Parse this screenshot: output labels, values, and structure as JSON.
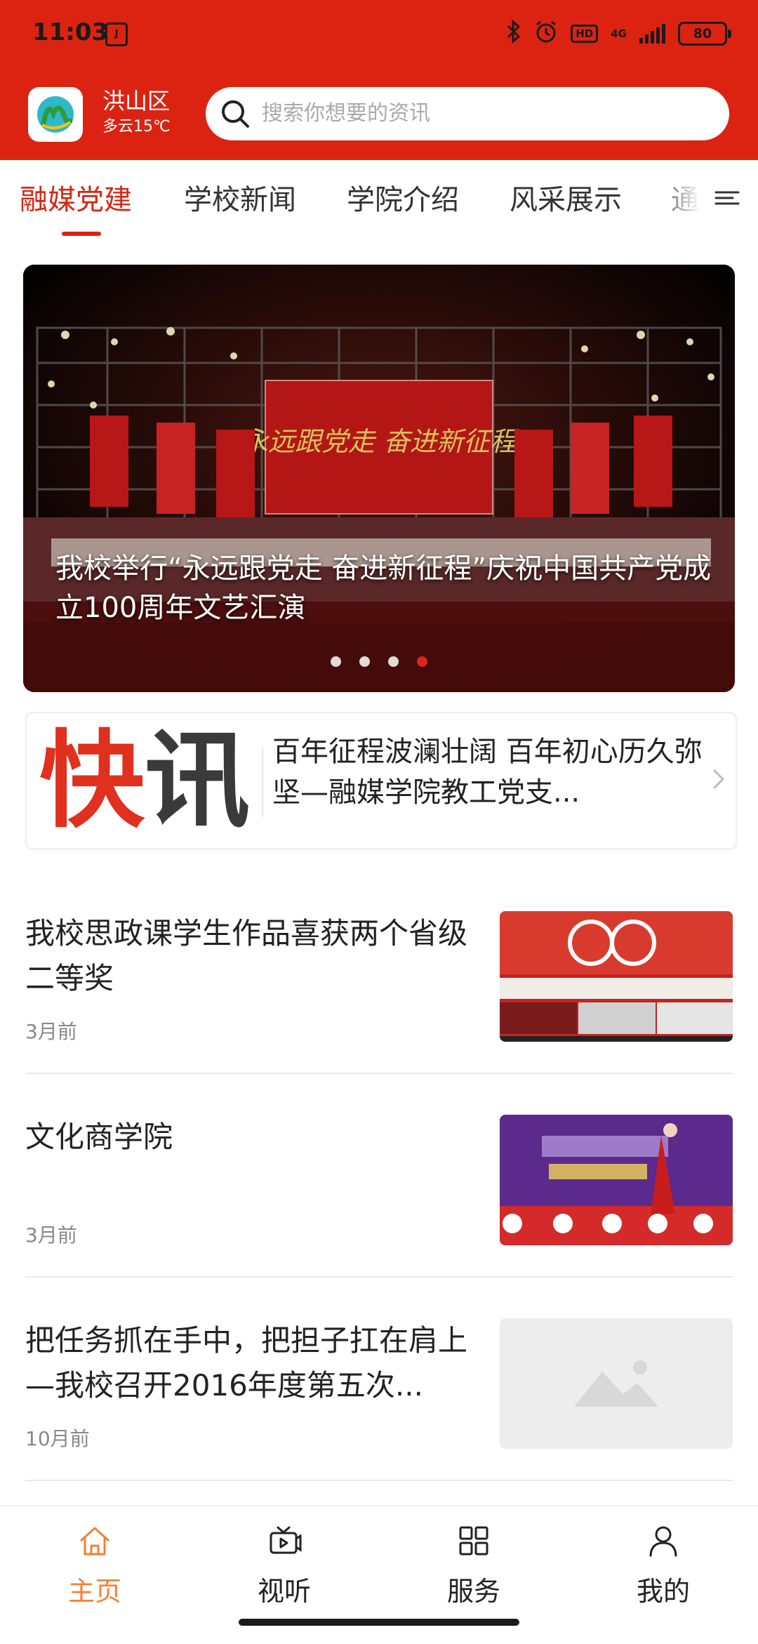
{
  "status_bar": {
    "time": "11:03",
    "sim_label": "J",
    "network": "4G",
    "battery": "80"
  },
  "header": {
    "city": "洪山区",
    "weather": "多云15℃",
    "search_placeholder": "搜索你想要的资讯",
    "accent_color": "#dc2311"
  },
  "tabs": [
    {
      "label": "融媒党建",
      "active": true
    },
    {
      "label": "学校新闻",
      "active": false
    },
    {
      "label": "学院介绍",
      "active": false
    },
    {
      "label": "风采展示",
      "active": false
    },
    {
      "label": "通",
      "active": false
    }
  ],
  "banner": {
    "caption": "我校举行“永远跟党走 奋进新征程”庆祝中国共产党成立100周年文艺汇演",
    "slide_count": 4,
    "active_slide": 4
  },
  "flash_news": {
    "logo_char_1": "快",
    "logo_char_2": "讯",
    "text": "百年征程波澜壮阔 百年初心历久弥坚—融媒学院教工党支..."
  },
  "news": [
    {
      "title": "我校思政课学生作品喜获两个省级二等奖",
      "time": "3月前",
      "thumb": "red-collage"
    },
    {
      "title": "文化商学院",
      "time": "3月前",
      "thumb": "purple-stage"
    },
    {
      "title": "把任务抓在手中，把担子扛在肩上—我校召开2016年度第五次...",
      "time": "10月前",
      "thumb": "placeholder"
    }
  ],
  "bottom_nav": [
    {
      "label": "主页",
      "icon": "home-icon",
      "active": true
    },
    {
      "label": "视听",
      "icon": "tv-icon",
      "active": false
    },
    {
      "label": "服务",
      "icon": "grid-icon",
      "active": false
    },
    {
      "label": "我的",
      "icon": "person-icon",
      "active": false
    }
  ],
  "colors": {
    "brand_red": "#dc2311",
    "nav_active": "#f28134",
    "dot_active": "#e02418"
  }
}
